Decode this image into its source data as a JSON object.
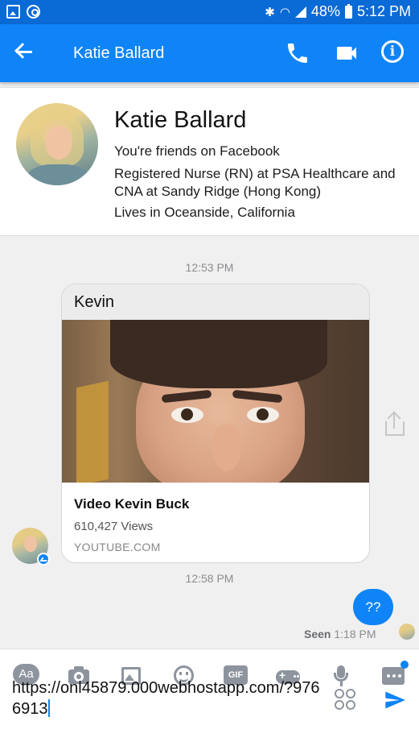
{
  "status_bar": {
    "battery": "48%",
    "time": "5:12 PM",
    "icons": [
      "gallery-icon",
      "data-saver-icon",
      "bluetooth-icon",
      "wifi-icon",
      "signal-icon",
      "battery-icon"
    ]
  },
  "app_bar": {
    "title": "Katie Ballard",
    "icons": [
      "back-arrow-icon",
      "phone-icon",
      "video-camera-icon",
      "info-icon"
    ],
    "info_glyph": "i"
  },
  "profile": {
    "name": "Katie Ballard",
    "friends_text": "You're friends on Facebook",
    "work": "Registered Nurse (RN) at PSA Healthcare and CNA at Sandy Ridge (Hong Kong)",
    "lives": "Lives in Oceanside, California"
  },
  "messages": {
    "time_1": "12:53 PM",
    "shared_card": {
      "sender": "Kevin",
      "title": "Video Kevin Buck",
      "views": "610,427 Views",
      "domain": "YOUTUBE.COM"
    },
    "time_2": "12:58 PM",
    "outgoing_text": "??",
    "seen_label": "Seen",
    "seen_time": "1:18 PM"
  },
  "toolbar": {
    "aa_label": "Aa",
    "gif_label": "GIF",
    "icons": [
      "camera-icon",
      "gallery-icon",
      "emoji-icon",
      "gif-icon",
      "game-controller-icon",
      "microphone-icon",
      "more-icon"
    ]
  },
  "composer": {
    "value": "https://onl45879.000webhostapp.com/?9766913"
  },
  "colors": {
    "status_bar": "#0a6ad6",
    "app_bar": "#0f84f6",
    "accent": "#0f84f6",
    "icon_gray": "#8d949e"
  }
}
